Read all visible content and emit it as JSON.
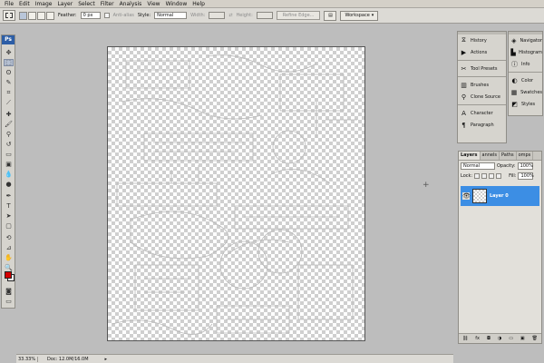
{
  "menu": [
    "File",
    "Edit",
    "Image",
    "Layer",
    "Select",
    "Filter",
    "Analysis",
    "View",
    "Window",
    "Help"
  ],
  "options": {
    "feather_label": "Feather:",
    "feather_value": "0 px",
    "antialias_label": "Anti-alias",
    "style_label": "Style:",
    "style_value": "Normal",
    "width_label": "Width:",
    "height_label": "Height:",
    "refine_label": "Refine Edge...",
    "workspace_label": "Workspace"
  },
  "toolbox": {
    "logo": "Ps",
    "foreground_color": "#d40000",
    "background_color": "#ffffff"
  },
  "status": {
    "zoom": "33.33%",
    "doc": "Doc: 12.0M/16.0M"
  },
  "panels": {
    "group1": [
      "History",
      "Actions"
    ],
    "group2": [
      "Tool Presets"
    ],
    "group3": [
      "Brushes",
      "Clone Source"
    ],
    "group4": [
      "Character",
      "Paragraph"
    ],
    "right1": [
      "Navigator",
      "Histogram",
      "Info"
    ],
    "right2": [
      "Color",
      "Swatches",
      "Styles"
    ]
  },
  "layers": {
    "tabs": [
      "Layers",
      "annels",
      "Paths",
      "omps"
    ],
    "blend_mode": "Normal",
    "opacity_label": "Opacity:",
    "opacity_value": "100%",
    "lock_label": "Lock:",
    "fill_label": "Fill:",
    "fill_value": "100%",
    "layer_name": "Layer 0",
    "selected_color": "#3c8ee4"
  }
}
